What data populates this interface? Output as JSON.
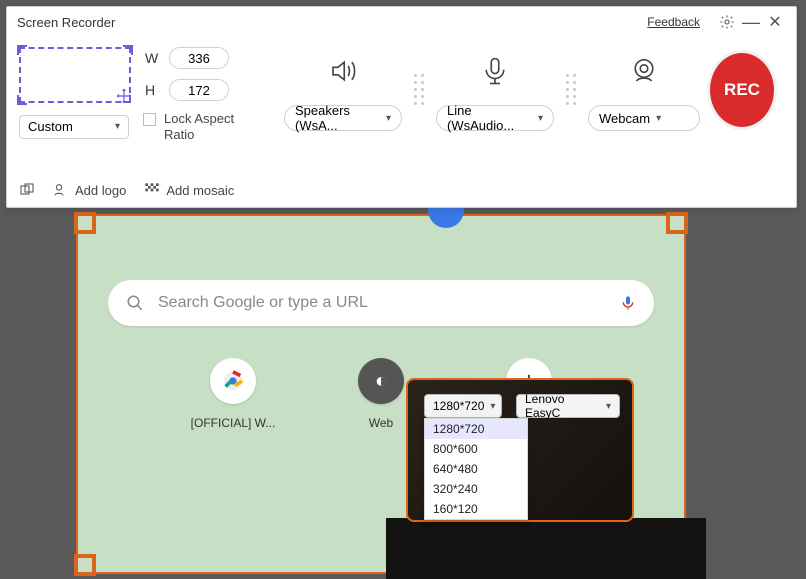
{
  "app": {
    "title": "Screen Recorder",
    "feedback": "Feedback"
  },
  "region": {
    "width": "336",
    "height": "172",
    "w_label": "W",
    "h_label": "H",
    "preset": "Custom",
    "lock_label": "Lock Aspect Ratio"
  },
  "audio": {
    "label": "Speakers (WsA..."
  },
  "mic": {
    "label": "Line (WsAudio..."
  },
  "webcam": {
    "label": "Webcam"
  },
  "record": {
    "label": "REC"
  },
  "toolbar": {
    "add_logo": "Add logo",
    "add_mosaic": "Add mosaic"
  },
  "browser": {
    "search_placeholder": "Search Google or type a URL",
    "tiles": [
      {
        "label": "[OFFICIAL] W..."
      },
      {
        "label": "Web"
      },
      {
        "label": ""
      }
    ]
  },
  "webcam_overlay": {
    "resolution": "1280*720",
    "camera": "Lenovo EasyC",
    "options": [
      "1280*720",
      "800*600",
      "640*480",
      "320*240",
      "160*120"
    ]
  }
}
